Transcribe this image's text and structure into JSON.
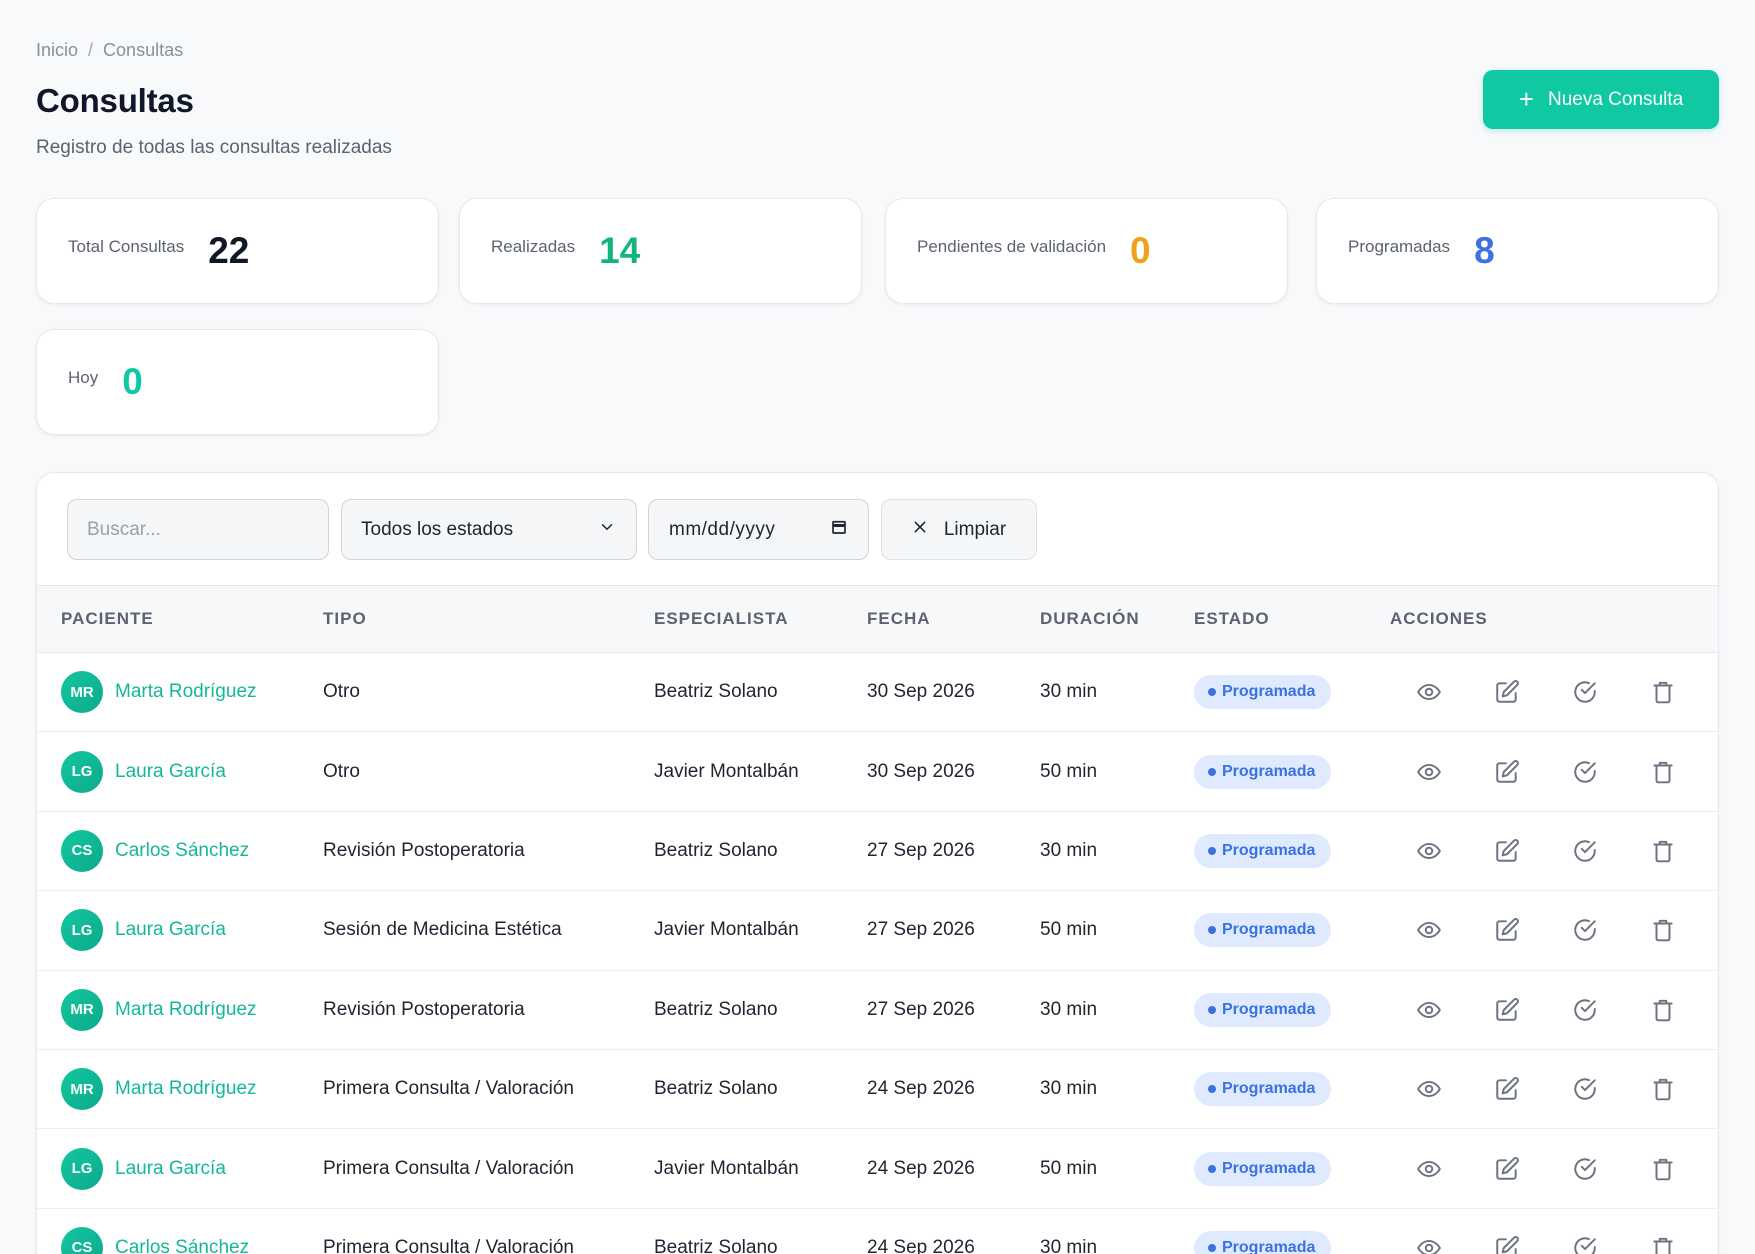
{
  "breadcrumb": {
    "home": "Inicio",
    "separator": "/",
    "current": "Consultas"
  },
  "header": {
    "title": "Consultas",
    "subtitle": "Registro de todas las consultas realizadas",
    "new_button_label": "Nueva Consulta",
    "new_button_icon": "plus-icon",
    "accent_color": "#10c9a3"
  },
  "stats": [
    {
      "label": "Total Consultas",
      "value": "22",
      "color": "#0f1729"
    },
    {
      "label": "Realizadas",
      "value": "14",
      "color": "#13b57f"
    },
    {
      "label": "Pendientes de validación",
      "value": "0",
      "color": "#f0a01c"
    },
    {
      "label": "Programadas",
      "value": "8",
      "color": "#3b72e0"
    },
    {
      "label": "Hoy",
      "value": "0",
      "color": "#10c9a3"
    }
  ],
  "filters": {
    "search_placeholder": "Buscar...",
    "status_select": "Todos los estados",
    "date_placeholder": "mm/dd/yyyy",
    "clear_label": "Limpiar"
  },
  "table": {
    "columns": [
      "PACIENTE",
      "TIPO",
      "ESPECIALISTA",
      "FECHA",
      "DURACIÓN",
      "ESTADO",
      "ACCIONES"
    ],
    "action_icons": [
      "eye-icon",
      "edit-icon",
      "check-circle-icon",
      "trash-icon"
    ],
    "status_color": "#3b72e0",
    "rows": [
      {
        "initials": "MR",
        "patient": "Marta Rodríguez",
        "type": "Otro",
        "specialist": "Beatriz Solano",
        "date": "30 Sep 2026",
        "duration": "30 min",
        "status": "Programada"
      },
      {
        "initials": "LG",
        "patient": "Laura García",
        "type": "Otro",
        "specialist": "Javier Montalbán",
        "date": "30 Sep 2026",
        "duration": "50 min",
        "status": "Programada"
      },
      {
        "initials": "CS",
        "patient": "Carlos Sánchez",
        "type": "Revisión Postoperatoria",
        "specialist": "Beatriz Solano",
        "date": "27 Sep 2026",
        "duration": "30 min",
        "status": "Programada"
      },
      {
        "initials": "LG",
        "patient": "Laura García",
        "type": "Sesión de Medicina Estética",
        "specialist": "Javier Montalbán",
        "date": "27 Sep 2026",
        "duration": "50 min",
        "status": "Programada"
      },
      {
        "initials": "MR",
        "patient": "Marta Rodríguez",
        "type": "Revisión Postoperatoria",
        "specialist": "Beatriz Solano",
        "date": "27 Sep 2026",
        "duration": "30 min",
        "status": "Programada"
      },
      {
        "initials": "MR",
        "patient": "Marta Rodríguez",
        "type": "Primera Consulta / Valoración",
        "specialist": "Beatriz Solano",
        "date": "24 Sep 2026",
        "duration": "30 min",
        "status": "Programada"
      },
      {
        "initials": "LG",
        "patient": "Laura García",
        "type": "Primera Consulta / Valoración",
        "specialist": "Javier Montalbán",
        "date": "24 Sep 2026",
        "duration": "50 min",
        "status": "Programada"
      },
      {
        "initials": "CS",
        "patient": "Carlos Sánchez",
        "type": "Primera Consulta / Valoración",
        "specialist": "Beatriz Solano",
        "date": "24 Sep 2026",
        "duration": "30 min",
        "status": "Programada"
      }
    ]
  }
}
